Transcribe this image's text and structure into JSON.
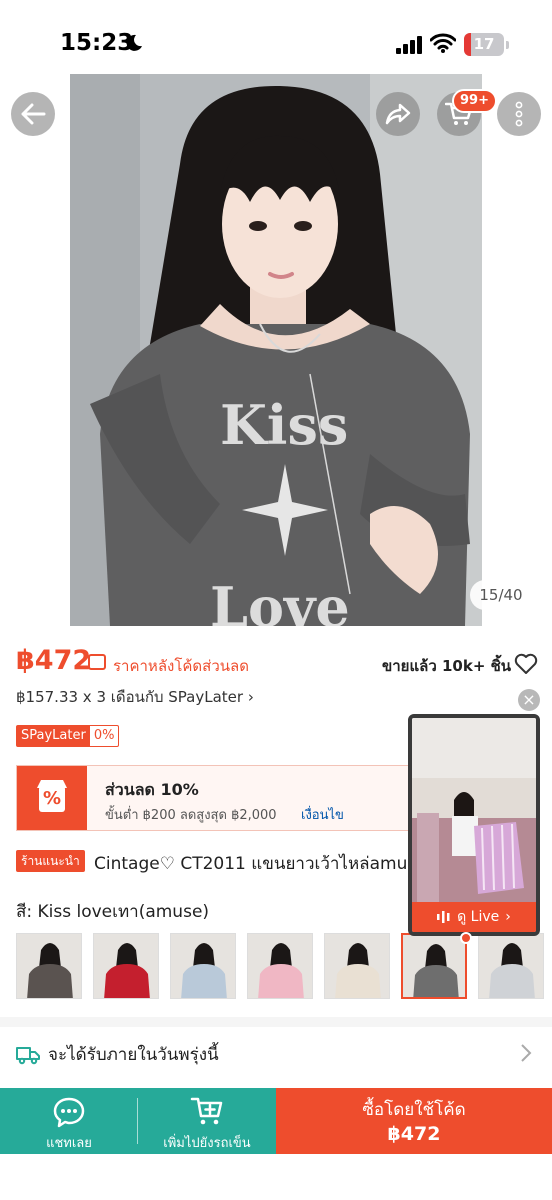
{
  "status": {
    "time": "15:23",
    "battery": "17",
    "battery_level": 0.17
  },
  "top_actions": {
    "cart_badge": "99+"
  },
  "gallery": {
    "counter": "15/40"
  },
  "product": {
    "price": "฿472",
    "price_note": "ราคาหลังโค้ดส่วนลด",
    "sold": "ขายแล้ว 10k+ ชิ้น",
    "paylater_line": "฿157.33 x 3 เดือนกับ SPayLater",
    "spay_left": "SPayLater",
    "spay_right": "0%",
    "shop_tag": "ร้านแนะนำ",
    "title": "Cintage♡ CT2011 แขนยาวเว้าไหล่amuse"
  },
  "voucher": {
    "title": "ส่วนลด 10%",
    "detail": "ขั้นต่ำ ฿200 ลดสูงสุด ฿2,000",
    "link": "เงื่อนไข",
    "icon_text": "%"
  },
  "variants": {
    "label": "สี: Kiss loveเทา(amuse)",
    "selected_index": 5,
    "colors": [
      "#5a5350",
      "#c41f2e",
      "#b9c9d9",
      "#f0b7c4",
      "#e9e0d3",
      "#6e6e6e",
      "#cfd2d6"
    ]
  },
  "live": {
    "button": "ดู Live",
    "close": "×"
  },
  "delivery": {
    "text": "จะได้รับภายในวันพรุ่งนี้"
  },
  "bottom_bar": {
    "chat": "แชทเลย",
    "add_cart": "เพิ่มไปยังรถเข็น",
    "buy_line1": "ซื้อโดยใช้โค้ด",
    "buy_line2": "฿472"
  },
  "colors": {
    "accent": "#ee4d2d",
    "teal": "#26aa99",
    "link": "#0055aa"
  }
}
